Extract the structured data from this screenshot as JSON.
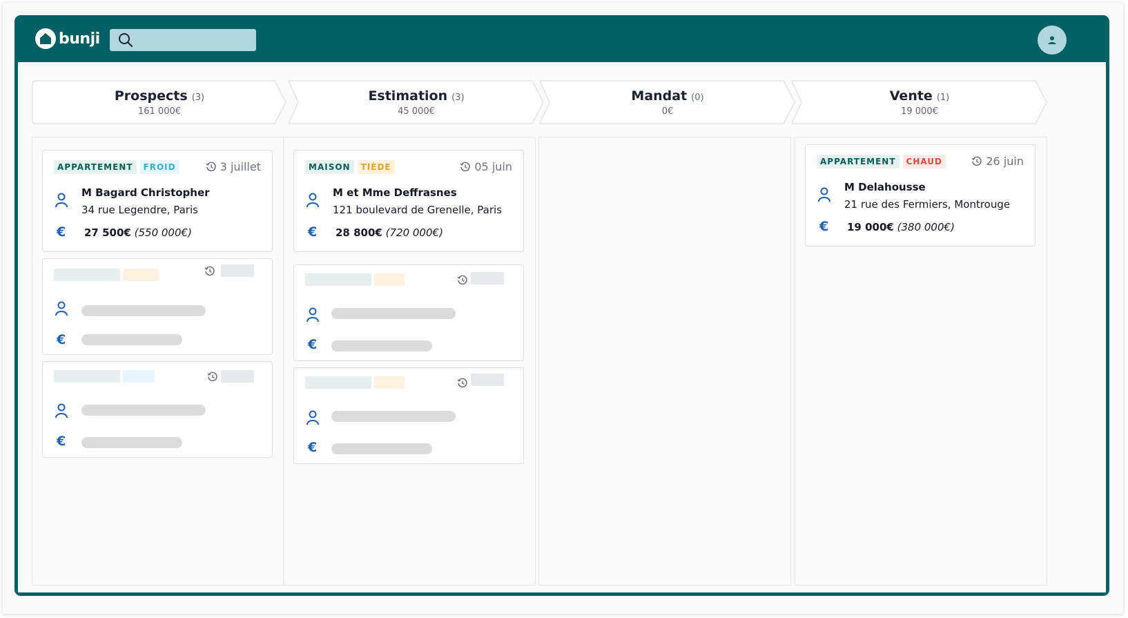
{
  "app": {
    "brand": "bunji",
    "search": {
      "value": "",
      "placeholder": ""
    },
    "colors": {
      "primary": "#006064",
      "search_bg": "#b2d6de",
      "accent_icon": "#2160ad"
    },
    "icons": {
      "logo": "house-icon",
      "search": "search-icon",
      "user": "user-icon",
      "person": "person-icon",
      "euro": "euro-icon",
      "history": "history-icon"
    }
  },
  "stages": [
    {
      "title": "Prospects",
      "count": "(3)",
      "amount": "161 000€"
    },
    {
      "title": "Estimation",
      "count": "(3)",
      "amount": "45 000€"
    },
    {
      "title": "Mandat",
      "count": "(0)",
      "amount": "0€"
    },
    {
      "title": "Vente",
      "count": "(1)",
      "amount": "19 000€"
    }
  ],
  "cards": {
    "prospects": {
      "type": "APPARTEMENT",
      "temperature": "FROID",
      "date": "3 juillet",
      "name": "M Bagard Christopher",
      "address": "34 rue Legendre, Paris",
      "fee": "27 500€",
      "price": "(550 000€)"
    },
    "estimation": {
      "type": "MAISON",
      "temperature": "TIÈDE",
      "date": "05 juin",
      "name": "M et Mme Deffrasnes",
      "address": "121 boulevard de Grenelle, Paris",
      "fee": "28 800€",
      "price": "(720 000€)"
    },
    "vente": {
      "type": "APPARTEMENT",
      "temperature": "CHAUD",
      "date": "26 juin",
      "name": "M Delahousse",
      "address": "21 rue des Fermiers, Montrouge",
      "fee": "19 000€",
      "price": "(380 000€)"
    }
  },
  "euro_symbol": "€"
}
